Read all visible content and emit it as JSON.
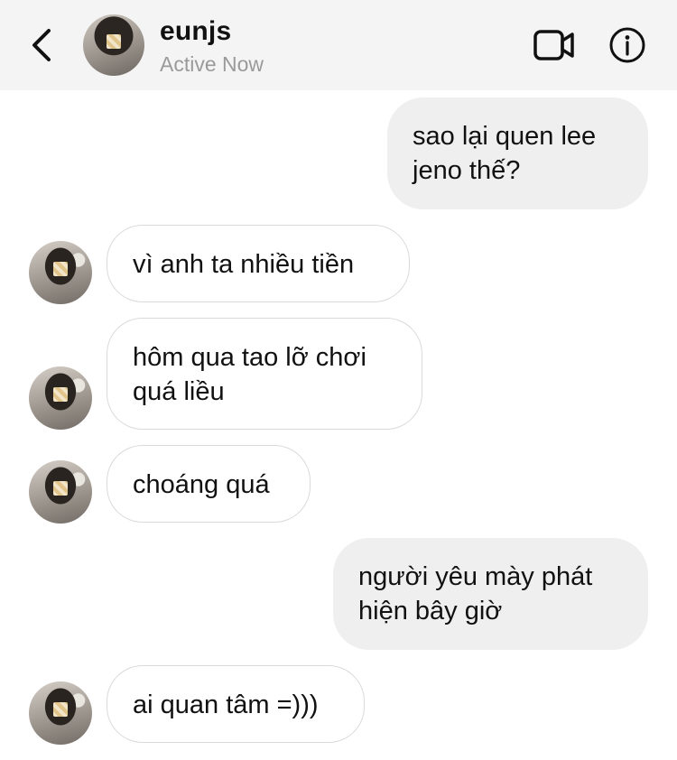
{
  "header": {
    "username": "eunjs",
    "status": "Active Now",
    "back_icon": "chevron-left-icon",
    "video_icon": "video-camera-icon",
    "info_icon": "info-icon"
  },
  "messages": [
    {
      "direction": "sent",
      "text": "sao lại quen lee jeno thế?"
    },
    {
      "direction": "received",
      "text": "vì anh ta nhiều tiền"
    },
    {
      "direction": "received",
      "text": "hôm qua tao lỡ chơi quá liều"
    },
    {
      "direction": "received",
      "text": "choáng quá"
    },
    {
      "direction": "sent",
      "text": "người yêu mày phát hiện bây giờ"
    },
    {
      "direction": "received",
      "text": "ai quan tâm =)))"
    }
  ],
  "colors": {
    "header_bg": "#f4f4f4",
    "sent_bubble_bg": "#efefef",
    "received_bubble_border": "#dadada",
    "status_text": "#9a9a9a"
  }
}
